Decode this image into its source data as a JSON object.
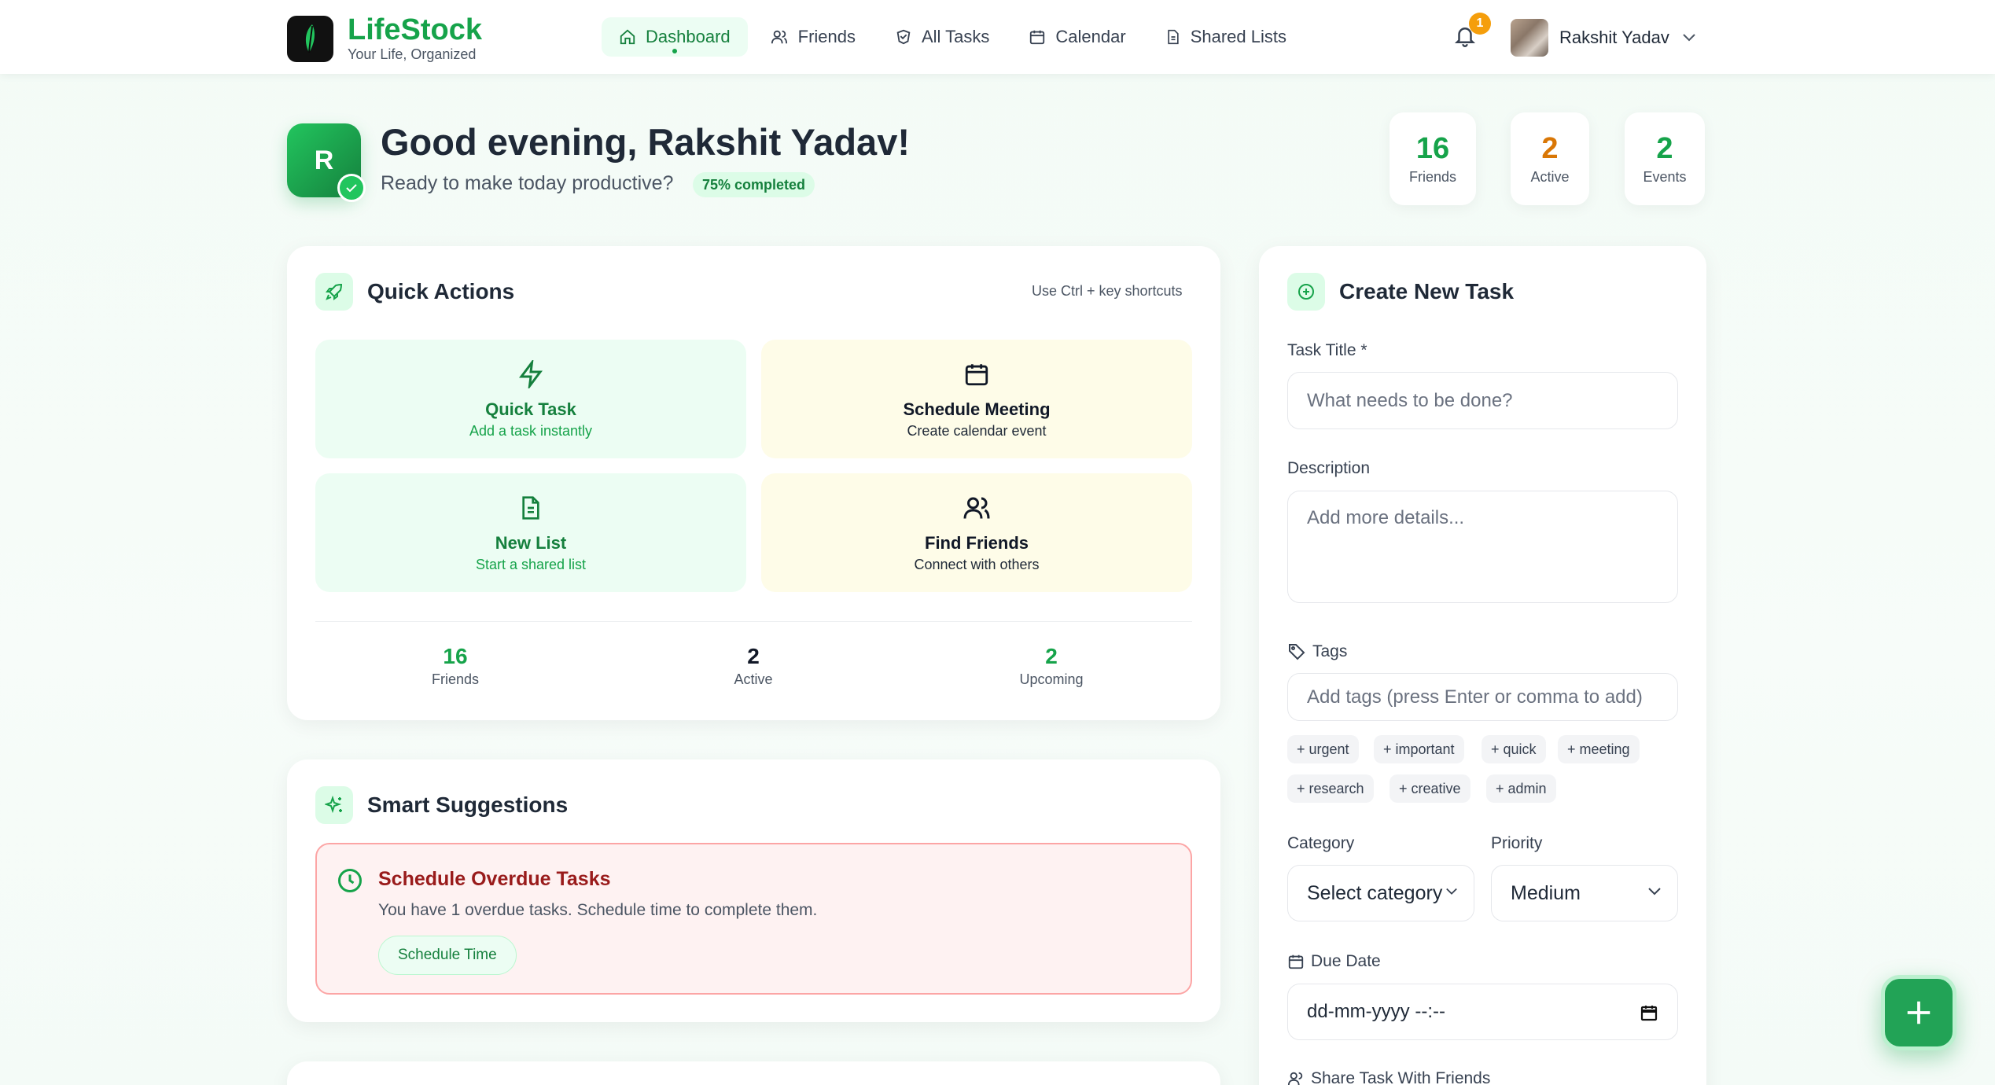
{
  "brand": {
    "name": "LifeStock",
    "tagline": "Your Life, Organized",
    "accent": "#16a34a"
  },
  "nav": {
    "items": [
      {
        "label": "Dashboard",
        "icon": "home-icon",
        "active": true
      },
      {
        "label": "Friends",
        "icon": "users-icon"
      },
      {
        "label": "All Tasks",
        "icon": "tasks-icon"
      },
      {
        "label": "Calendar",
        "icon": "calendar-icon"
      },
      {
        "label": "Shared Lists",
        "icon": "document-icon"
      }
    ],
    "notifications_count": "1",
    "user_name": "Rakshit Yadav"
  },
  "greeting": {
    "avatar_letter": "R",
    "title": "Good evening, Rakshit Yadav!",
    "subtitle": "Ready to make today productive?",
    "progress_badge": "75% completed",
    "stats": [
      {
        "value": "16",
        "label": "Friends",
        "color": "#16a34a"
      },
      {
        "value": "2",
        "label": "Active",
        "color": "#d97706"
      },
      {
        "value": "2",
        "label": "Events",
        "color": "#16a34a"
      }
    ]
  },
  "quick_actions": {
    "title": "Quick Actions",
    "hint": "Use Ctrl + key shortcuts",
    "tiles": [
      {
        "title": "Quick Task",
        "subtitle": "Add a task instantly",
        "icon": "lightning-icon"
      },
      {
        "title": "Schedule Meeting",
        "subtitle": "Create calendar event",
        "icon": "calendar-icon"
      },
      {
        "title": "New List",
        "subtitle": "Start a shared list",
        "icon": "document-icon"
      },
      {
        "title": "Find Friends",
        "subtitle": "Connect with others",
        "icon": "users-icon"
      }
    ],
    "stats": [
      {
        "value": "16",
        "label": "Friends"
      },
      {
        "value": "2",
        "label": "Active"
      },
      {
        "value": "2",
        "label": "Upcoming"
      }
    ]
  },
  "suggestions": {
    "title": "Smart Suggestions",
    "item": {
      "title": "Schedule Overdue Tasks",
      "text": "You have 1 overdue tasks. Schedule time to complete them.",
      "button": "Schedule Time"
    }
  },
  "create_task": {
    "title": "Create New Task",
    "task_title_label": "Task Title *",
    "task_title_placeholder": "What needs to be done?",
    "description_label": "Description",
    "description_placeholder": "Add more details...",
    "tags_label": "Tags",
    "tags_placeholder": "Add tags (press Enter or comma to add)",
    "tag_suggestions": [
      "+ urgent",
      "+ important",
      "+ quick",
      "+ meeting",
      "+ research",
      "+ creative",
      "+ admin"
    ],
    "category_label": "Category",
    "category_value": "Select category",
    "priority_label": "Priority",
    "priority_value": "Medium",
    "due_date_label": "Due Date",
    "due_date_value": "dd-mm-yyyy --:--",
    "share_label": "Share Task With Friends"
  }
}
